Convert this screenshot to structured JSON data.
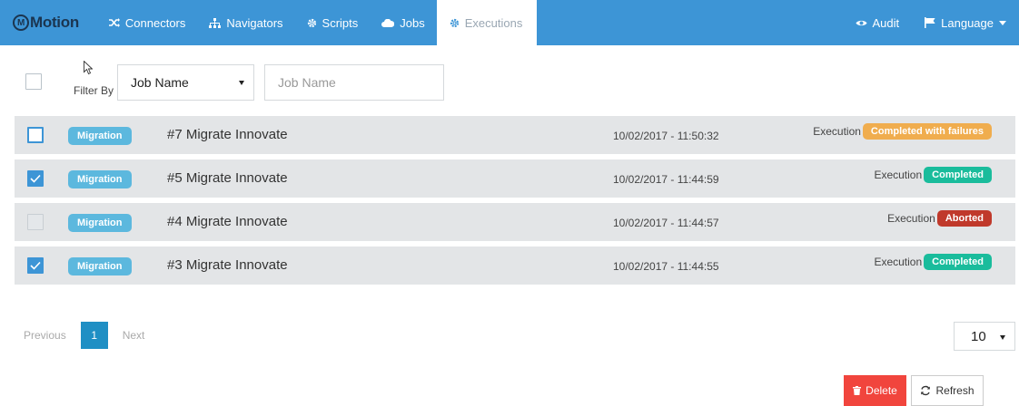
{
  "navbar": {
    "brand_logo": "M",
    "brand": "Motion",
    "items": [
      {
        "label": "Connectors",
        "icon": "shuffle-icon"
      },
      {
        "label": "Navigators",
        "icon": "sitemap-icon"
      },
      {
        "label": "Scripts",
        "icon": "gear-icon"
      },
      {
        "label": "Jobs",
        "icon": "cloud-icon"
      },
      {
        "label": "Executions",
        "icon": "gear-icon",
        "active": true
      }
    ],
    "right": [
      {
        "label": "Audit",
        "icon": "eye-icon"
      },
      {
        "label": "Language",
        "icon": "flag-icon"
      }
    ],
    "color": "#3d95d6"
  },
  "filter": {
    "label": "Filter By",
    "select_value": "Job Name",
    "input_placeholder": "Job Name"
  },
  "rows": [
    {
      "tag": "Migration",
      "title": "#7 Migrate Innovate",
      "date": "10/02/2017 - 11:50:32",
      "status_label": "Execution",
      "status": "Completed with failures",
      "status_color": "#f0ad4e",
      "checkbox": "unchecked-highlight"
    },
    {
      "tag": "Migration",
      "title": "#5 Migrate Innovate",
      "date": "10/02/2017 - 11:44:59",
      "status_label": "Execution",
      "status": "Completed",
      "status_color": "#1abc9c",
      "checkbox": "checked"
    },
    {
      "tag": "Migration",
      "title": "#4 Migrate Innovate",
      "date": "10/02/2017 - 11:44:57",
      "status_label": "Execution",
      "status": "Aborted",
      "status_color": "#c0392b",
      "checkbox": "disabled"
    },
    {
      "tag": "Migration",
      "title": "#3 Migrate Innovate",
      "date": "10/02/2017 - 11:44:55",
      "status_label": "Execution",
      "status": "Completed",
      "status_color": "#1abc9c",
      "checkbox": "checked"
    }
  ],
  "pagination": {
    "previous": "Previous",
    "current": "1",
    "next": "Next",
    "page_size": "10"
  },
  "actions": {
    "delete": "Delete",
    "refresh": "Refresh"
  }
}
